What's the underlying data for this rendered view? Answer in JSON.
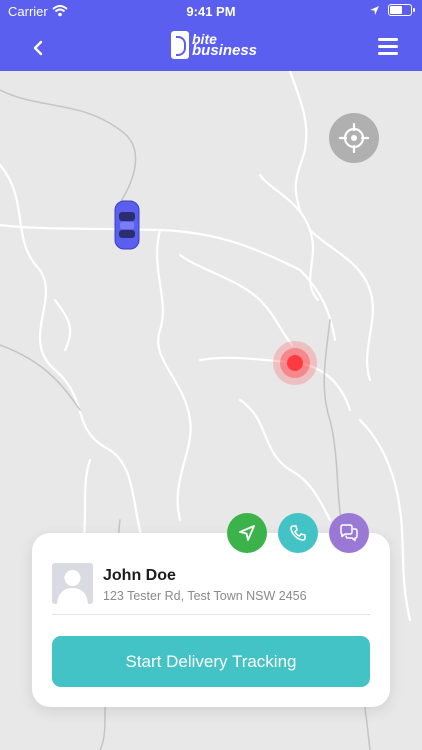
{
  "status_bar": {
    "carrier": "Carrier",
    "time": "9:41 PM"
  },
  "header": {
    "logo_line1": "bite",
    "logo_line2": "business"
  },
  "customer": {
    "name": "John Doe",
    "address": "123 Tester Rd, Test Town NSW 2456"
  },
  "actions": {
    "start_tracking_label": "Start Delivery Tracking"
  },
  "icons": [
    "wifi-icon",
    "location-arrow-icon",
    "battery-icon",
    "back-chevron-icon",
    "hamburger-menu-icon",
    "crosshair-icon",
    "car-icon",
    "destination-pin-icon",
    "navigation-icon",
    "phone-icon",
    "chat-icon",
    "avatar-placeholder-icon"
  ],
  "colors": {
    "header": "#5a5ff0",
    "primary_cta": "#44c3c6",
    "navigate": "#3bb34a",
    "call": "#44c3c6",
    "chat": "#9a78d5",
    "destination": "#ff3b42"
  }
}
